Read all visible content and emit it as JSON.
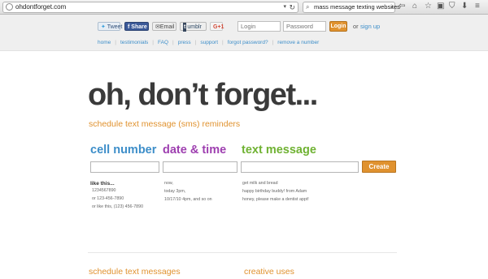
{
  "browser": {
    "url": "ohdontforget.com",
    "search_query": "mass message texting websites"
  },
  "header": {
    "share": {
      "tweet": "Tweet",
      "share": "Share",
      "email": "Email",
      "tumblr_icon": "t",
      "tumblr": "umblr",
      "gplus": "G+1"
    },
    "login_placeholder": "Login",
    "password_placeholder": "Password",
    "login_button": "Login",
    "or": "or",
    "signup": "sign up",
    "nav": [
      "home",
      "testimonials",
      "FAQ",
      "press",
      "support",
      "forgot password?",
      "remove a number"
    ]
  },
  "hero": {
    "title": "oh, don’t forget...",
    "subtitle": "schedule text message (sms) reminders"
  },
  "form": {
    "cell_label": "cell number",
    "date_label": "date & time",
    "message_label": "text message",
    "create_button": "Create"
  },
  "examples": {
    "heading": "like this...",
    "cell": [
      "1234567890",
      "or 123-456-7890",
      "or like this, (123) 456-7890"
    ],
    "date": [
      "now,",
      "today 3pm,",
      "10/17/10 4pm, and so on"
    ],
    "message": [
      "get milk and bread",
      "happy birthday buddy! from Adam",
      "honey, please make a dentist appt!"
    ]
  },
  "sections": {
    "left": "schedule text messages",
    "right": "creative uses"
  },
  "colors": {
    "orange": "#e0922f",
    "blue": "#3d8ec9",
    "purple": "#9e3fb0",
    "green": "#6fb232",
    "title": "#3a3a3a"
  }
}
